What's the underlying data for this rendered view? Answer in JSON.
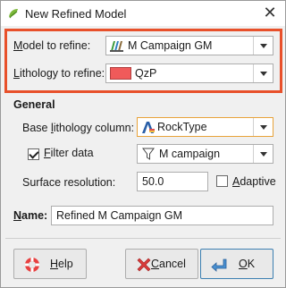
{
  "window": {
    "title": "New Refined Model",
    "close_symbol": "✕"
  },
  "refine": {
    "model_label": "Model to refine:",
    "model_value": "M Campaign GM",
    "lithology_label": "Lithology to refine:",
    "lithology_value": "QzP",
    "lithology_color": "#f05a5a",
    "highlight_color": "#e8502a"
  },
  "general": {
    "section_title": "General",
    "base_lithology_label": "Base lithology column:",
    "base_lithology_value": "RockType",
    "filter_label": "Filter data",
    "filter_checked": true,
    "filter_value": "M campaign",
    "surface_resolution_label": "Surface resolution:",
    "surface_resolution_value": "50.0",
    "adaptive_label": "Adaptive",
    "adaptive_checked": false
  },
  "name": {
    "label": "Name:",
    "value": "Refined M Campaign GM"
  },
  "buttons": {
    "help": "Help",
    "cancel": "Cancel",
    "ok": "OK"
  },
  "icons": {
    "app": "leapfrog-app-icon",
    "model": "geological-model-icon",
    "base_lithology": "lithology-column-icon",
    "filter": "filter-icon",
    "help": "lifebuoy-icon",
    "cancel": "red-x-icon",
    "ok": "enter-arrow-icon"
  }
}
